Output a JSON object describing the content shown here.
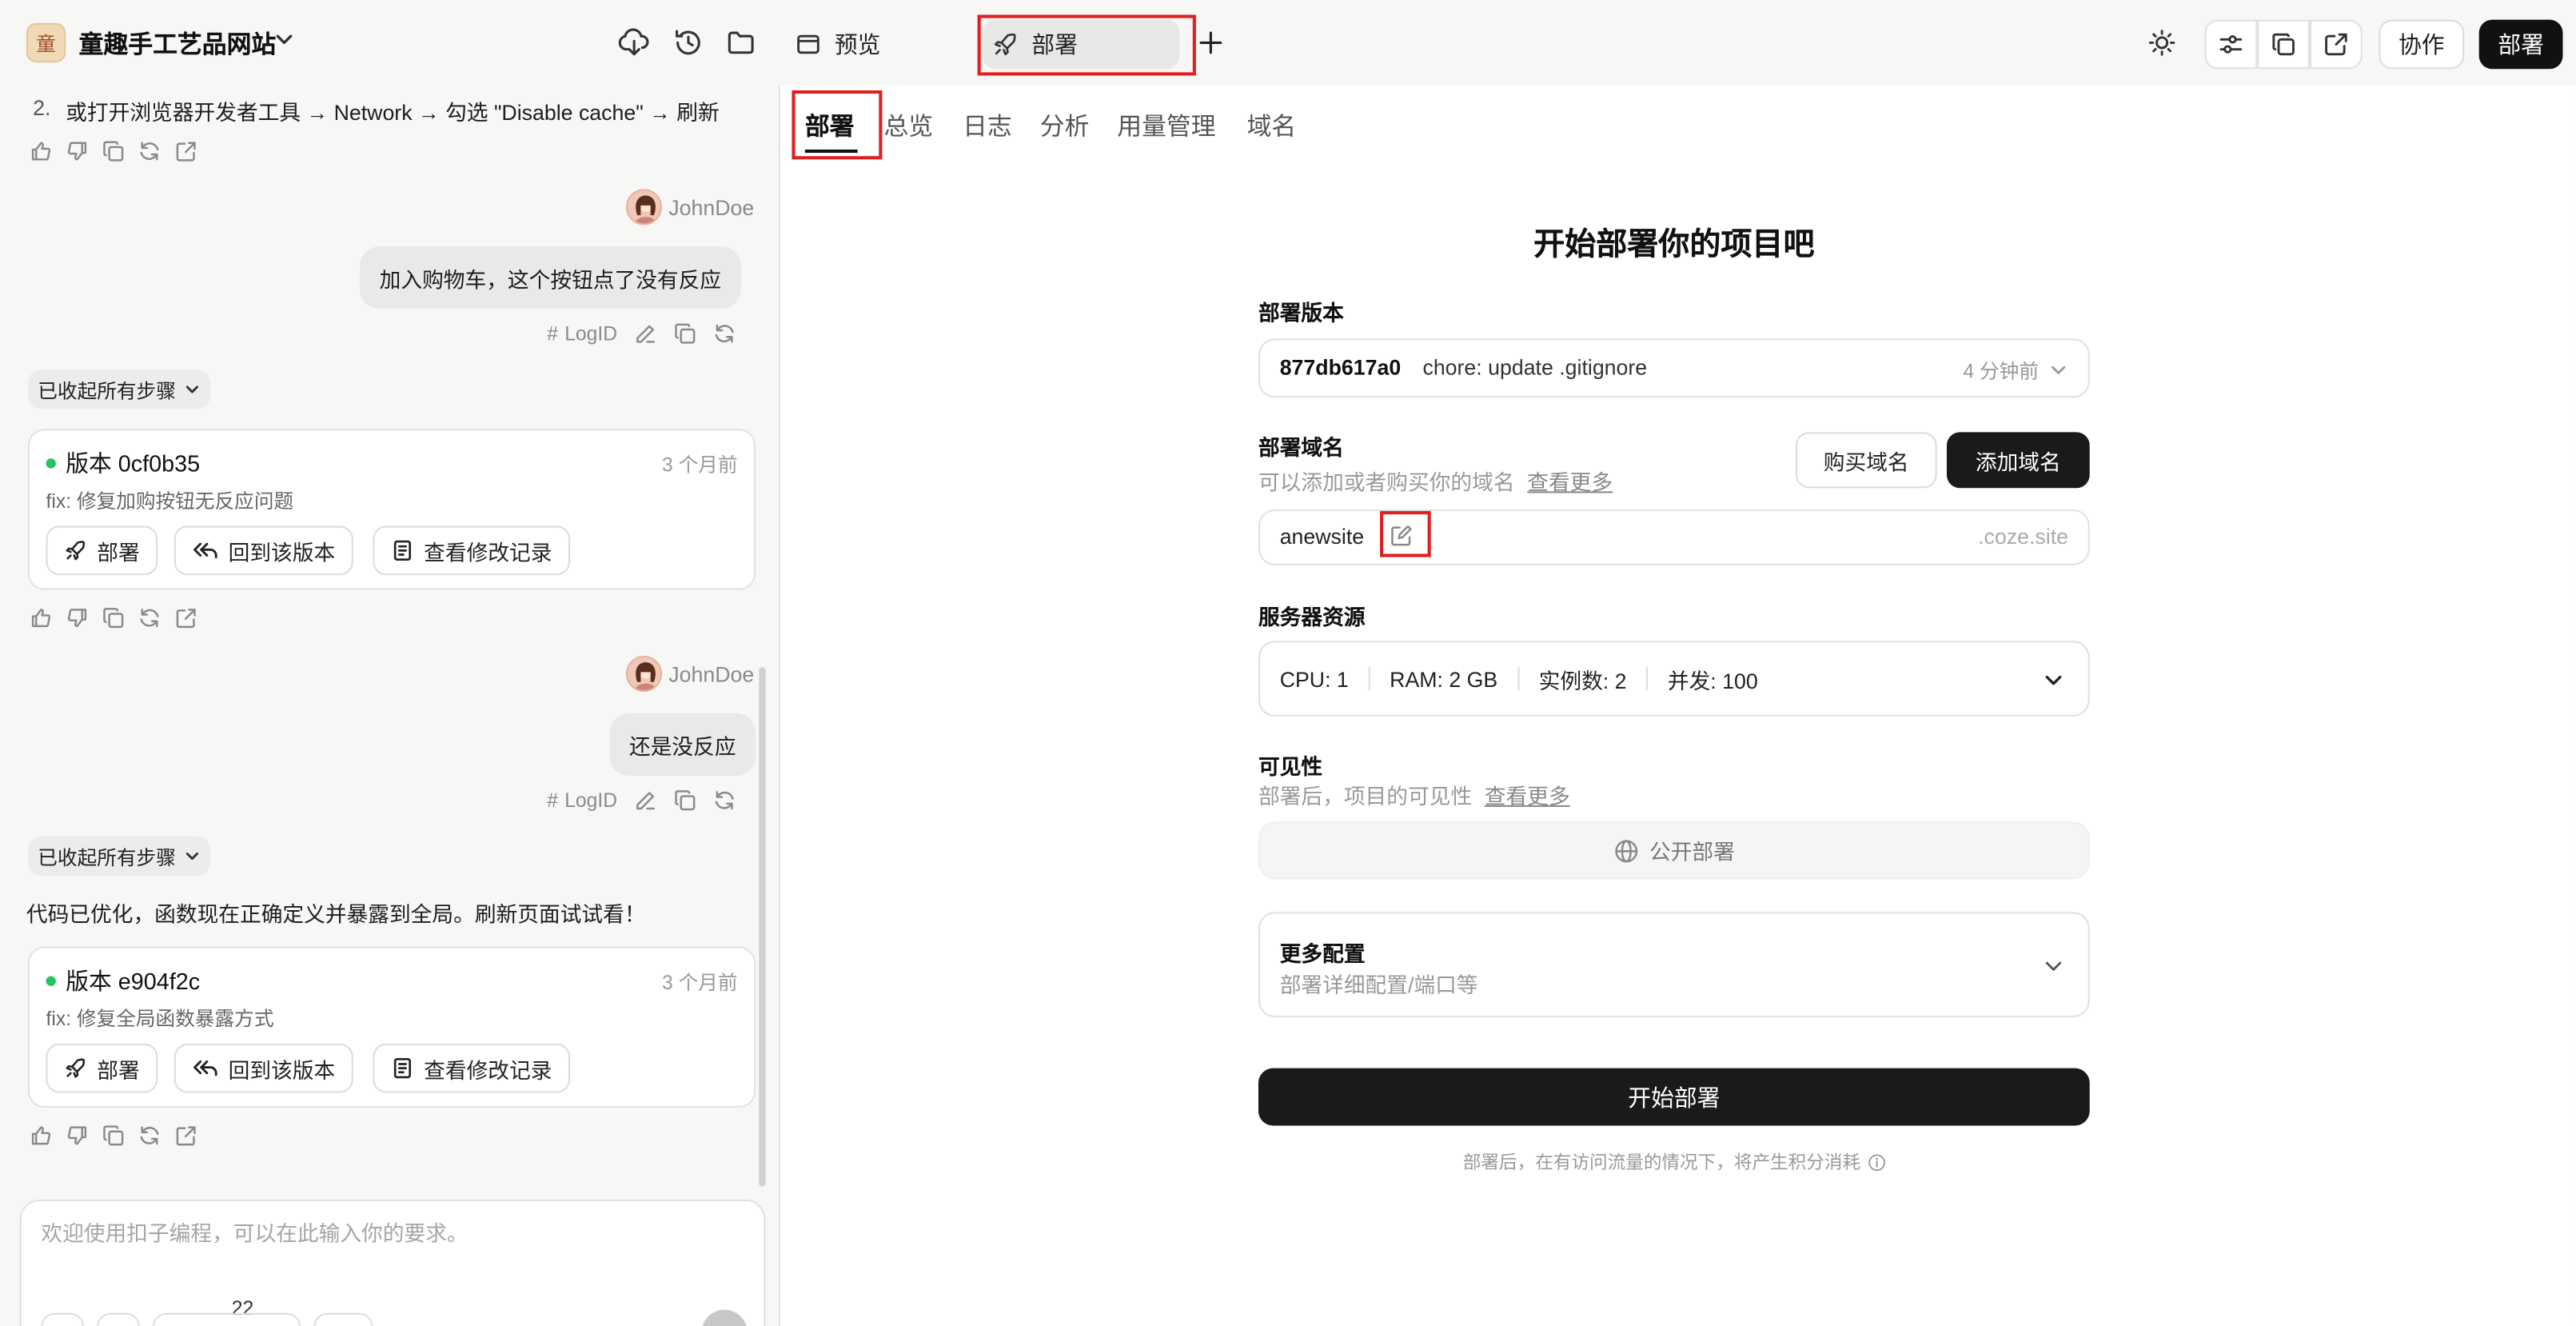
{
  "app": {
    "title": "童趣手工艺品网站",
    "logo_text": "童"
  },
  "tabs": {
    "preview_label": "预览",
    "deploy_label": "部署"
  },
  "toolbar": {
    "collab_label": "协作",
    "deploy_label": "部署"
  },
  "chat": {
    "partial_line": "或打开浏览器开发者工具 → Network → 勾选 \"Disable cache\" → 刷新",
    "partial_line_index": "2.",
    "user_name": "JohnDoe",
    "logid_label": "LogID",
    "steps_collapsed_label": "已收起所有步骤",
    "messages": [
      {
        "text": "加入购物车，这个按钮点了没有反应"
      },
      {
        "text": "还是没反应"
      }
    ],
    "assistant_reply": "代码已优化，函数现在正确定义并暴露到全局。刷新页面试试看！",
    "versions": [
      {
        "title": "版本 0cf0b35",
        "time": "3 个月前",
        "message": "fix: 修复加购按钮无反应问题"
      },
      {
        "title": "版本 e904f2c",
        "time": "3 个月前",
        "message": "fix: 修复全局函数暴露方式"
      }
    ],
    "version_buttons": {
      "deploy": "部署",
      "rollback": "回到该版本",
      "history": "查看修改记录"
    },
    "input_placeholder": "欢迎使用扣子编程，可以在此输入你的要求。",
    "input_badge": "22"
  },
  "deploy": {
    "subtabs": [
      "部署",
      "总览",
      "日志",
      "分析",
      "用量管理",
      "域名"
    ],
    "heading": "开始部署你的项目吧",
    "version_label": "部署版本",
    "version_hash": "877db617a0",
    "version_commit": "chore: update .gitignore",
    "version_time": "4 分钟前",
    "domain_label": "部署域名",
    "domain_hint": "可以添加或者购买你的域名",
    "see_more": "查看更多",
    "buy_domain": "购买域名",
    "add_domain": "添加域名",
    "subdomain": "anewsite",
    "domain_suffix": ".coze.site",
    "resources_label": "服务器资源",
    "resources": {
      "cpu": "CPU: 1",
      "ram": "RAM: 2 GB",
      "instances": "实例数: 2",
      "concurrency": "并发: 100"
    },
    "visibility_label": "可见性",
    "visibility_hint": "部署后，项目的可见性",
    "visibility_value": "公开部署",
    "more_config_title": "更多配置",
    "more_config_hint": "部署详细配置/端口等",
    "start_button": "开始部署",
    "footnote": "部署后，在有访问流量的情况下，将产生积分消耗"
  }
}
